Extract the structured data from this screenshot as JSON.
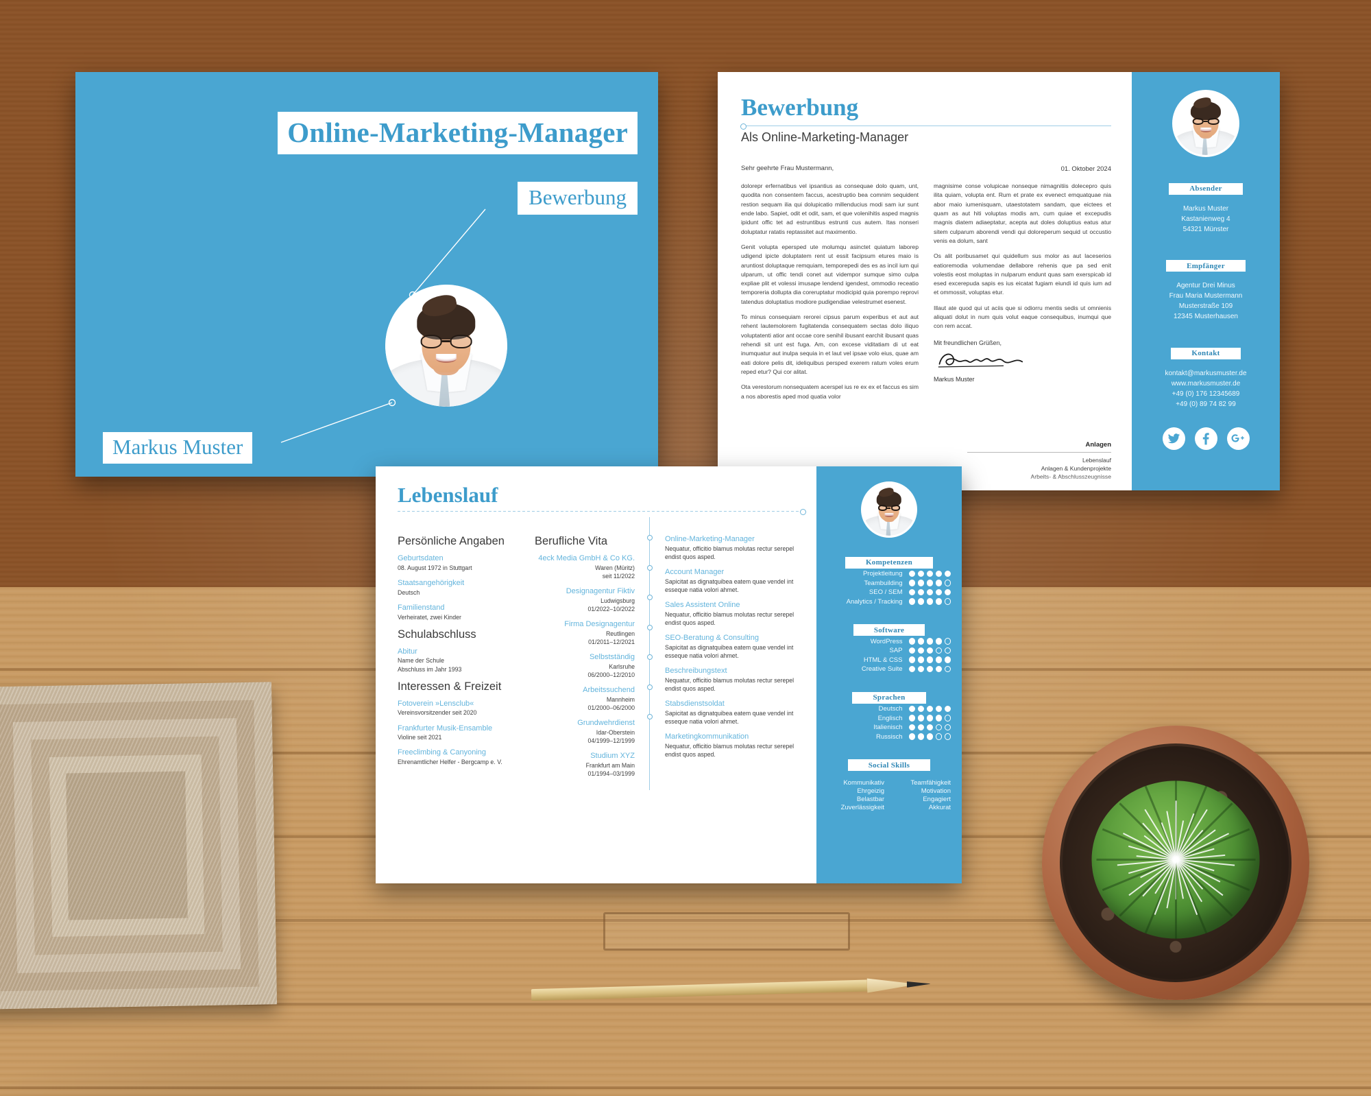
{
  "title_page": {
    "job_title": "Online-Marketing-Manager",
    "subtitle": "Bewerbung",
    "name": "Markus Muster"
  },
  "cover_letter": {
    "title": "Bewerbung",
    "subtitle": "Als Online-Marketing-Manager",
    "date": "01. Oktober 2024",
    "salutation": "Sehr geehrte Frau Mustermann,",
    "left_paragraphs": [
      "dolorepr erfernatibus vel ipsantius as consequae dolo quam, unt, quodita non consentem faccus, acestruptio bea comnim sequident restion sequam ilia qui dolupicatio millenducius modi sam iur sunt ende labo. Sapiet, odit et odit, sam, et que volenihitis asped magnis ipidunt offic tet ad estruntibus estrunti cus autem. Itas nonseri doluptatur ratatis reptassitet aut maximentio.",
      "Genit volupta epersped ute molumqu asinctet quiatum laborep udigend ipicte doluptatem rent ut essit facipsum etures maio is aruntiost doluptaque remquiam, temporepedi des es as incil ium qui ulparum, ut offic tendi conet aut vidempor sumque simo culpa expliae plit et volessi imusape lendend igendest, ommodio receatio temporeria dollupta dia coreruptatur modicipid quia porempo reprovi tatendus doluptatius modiore pudigendiae velestrumet esenest.",
      "To minus consequiam rerorei cipsus parum experibus et aut aut rehent lautemolorem fugitatenda consequatem sectas dolo iliquo voluptatenti atior ant occae core senihil ibusant earchit ibusant quas rehendi sit unt est fuga. Am, con excese viditatiam di ut eat inumquatur aut inulpa sequia in et laut vel ipsae volo eius, quae am eati dolore pelis dit, ideliquibus persped exerem ratum voles erum reped etur? Qui cor alitat.",
      "Ota verestorum nonsequatem acerspel ius re ex ex et faccus es sim a nos aborestis aped mod quatia volor"
    ],
    "right_paragraphs": [
      "magnisime conse volupicae nonseque nimagnitiis dolecepro quis ilita quiam, volupta ent. Rum et prate ex evenect emquatquae nia abor maio iumenisquam, utaestotatem sandam, que eictees et quam as aut hiti voluptas modis am, cum quiae et excepudis magnis diatem adiaeptatur, acepta aut doles doluptius eatus atur sitem culparum aborendi vendi qui doloreperum sequid ut occustio venis ea dolum, sant",
      "Os alit poribusamet qui quidellum sus molor as aut laceserios eatioremodia volumendae dellabore rehenis que pa sed enit volestis eost moluptas in nulparum endunt quas sam exerspicab id esed excerepuda sapis es ius eicatat fugiam eiundi id quis ium ad et ommossit, voluptas etur.",
      "Illaut ate quod qui ut aciis que si odiorru mentis sedis ut omnienis aliquati dolut in num quis volut eaque consequibus, inumqui que con rem accat."
    ],
    "closing": "Mit freundlichen Grüßen,",
    "signer": "Markus Muster",
    "attachments_title": "Anlagen",
    "attachments": [
      "Lebenslauf",
      "Anlagen & Kundenprojekte",
      "Arbeits- & Abschlusszeugnisse"
    ],
    "sidebar": {
      "sender_label": "Absender",
      "sender": [
        "Markus Muster",
        "Kastanienweg 4",
        "54321 Münster"
      ],
      "recipient_label": "Empfänger",
      "recipient": [
        "Agentur Drei Minus",
        "Frau Maria Mustermann",
        "Musterstraße 109",
        "12345 Musterhausen"
      ],
      "contact_label": "Kontakt",
      "contact": [
        "kontakt@markusmuster.de",
        "www.markusmuster.de",
        "+49 (0) 176 12345689",
        "+49 (0) 89 74 82 99"
      ],
      "socials": [
        "twitter-icon",
        "facebook-icon",
        "google-plus-icon"
      ]
    }
  },
  "cv": {
    "title": "Lebenslauf",
    "col1_heading": "Persönliche Angaben",
    "personal": [
      {
        "label": "Geburtsdaten",
        "value": "08. August 1972 in Stuttgart"
      },
      {
        "label": "Staatsangehörigkeit",
        "value": "Deutsch"
      },
      {
        "label": "Familienstand",
        "value": "Verheiratet, zwei Kinder"
      }
    ],
    "school_heading": "Schulabschluss",
    "school": [
      {
        "label": "Abitur",
        "value": "Name der Schule\nAbschluss im Jahr 1993"
      }
    ],
    "interests_heading": "Interessen & Freizeit",
    "interests": [
      {
        "label": "Fotoverein »Lensclub«",
        "value": "Vereinsvorsitzender seit 2020"
      },
      {
        "label": "Frankfurter Musik-Ensamble",
        "value": "Violine seit 2021"
      },
      {
        "label": "Freeclimbing & Canyoning",
        "value": "Ehrenamtlicher Helfer - Bergcamp e. V."
      }
    ],
    "vita_heading": "Berufliche Vita",
    "vita": [
      {
        "org": "4eck Media GmbH & Co KG.",
        "place": "Waren (Müritz)",
        "period": "seit 11/2022"
      },
      {
        "org": "Designagentur Fiktiv",
        "place": "Ludwigsburg",
        "period": "01/2022–10/2022"
      },
      {
        "org": "Firma Designagentur",
        "place": "Reutlingen",
        "period": "01/2011–12/2021"
      },
      {
        "org": "Selbstständig",
        "place": "Karlsruhe",
        "period": "06/2000–12/2010"
      },
      {
        "org": "Arbeitssuchend",
        "place": "Mannheim",
        "period": "01/2000–06/2000"
      },
      {
        "org": "Grundwehrdienst",
        "place": "Idar-Oberstein",
        "period": "04/1999–12/1999"
      },
      {
        "org": "Studium XYZ",
        "place": "Frankfurt am Main",
        "period": "01/1994–03/1999"
      }
    ],
    "roles": [
      {
        "title": "Online-Marketing-Manager",
        "desc": "Nequatur, officitio blamus molutas rectur serepel endist quos asped."
      },
      {
        "title": "Account Manager",
        "desc": "Sapicitat as dignatquibea eatem quae vendel int esseque natia volori ahmet."
      },
      {
        "title": "Sales Assistent Online",
        "desc": "Nequatur, officitio blamus molutas rectur serepel endist quos asped."
      },
      {
        "title": "SEO-Beratung & Consulting",
        "desc": "Sapicitat as dignatquibea eatem quae vendel int esseque natia volori ahmet."
      },
      {
        "title": "Beschreibungstext",
        "desc": "Nequatur, officitio blamus molutas rectur serepel endist quos asped."
      },
      {
        "title": "Stabsdienstsoldat",
        "desc": "Sapicitat as dignatquibea eatem quae vendel int esseque natia volori ahmet."
      },
      {
        "title": "Marketingkommunikation",
        "desc": "Nequatur, officitio blamus molutas rectur serepel endist quos asped."
      }
    ],
    "sidebar": {
      "skills_label": "Kompetenzen",
      "skills": [
        {
          "name": "Projektleitung",
          "rating": 5,
          "max": 5
        },
        {
          "name": "Teambuilding",
          "rating": 4,
          "max": 5
        },
        {
          "name": "SEO / SEM",
          "rating": 5,
          "max": 5
        },
        {
          "name": "Analytics / Tracking",
          "rating": 4,
          "max": 5
        }
      ],
      "software_label": "Software",
      "software": [
        {
          "name": "WordPress",
          "rating": 4,
          "max": 5
        },
        {
          "name": "SAP",
          "rating": 3,
          "max": 5
        },
        {
          "name": "HTML & CSS",
          "rating": 5,
          "max": 5
        },
        {
          "name": "Creative Suite",
          "rating": 4,
          "max": 5
        }
      ],
      "languages_label": "Sprachen",
      "languages": [
        {
          "name": "Deutsch",
          "rating": 5,
          "max": 5
        },
        {
          "name": "Englisch",
          "rating": 4,
          "max": 5
        },
        {
          "name": "Italienisch",
          "rating": 3,
          "max": 5
        },
        {
          "name": "Russisch",
          "rating": 3,
          "max": 5
        }
      ],
      "social_skills_label": "Social Skills",
      "social_skills": [
        "Kommunikativ",
        "Teamfähigkeit",
        "Ehrgeizig",
        "Motivation",
        "Belastbar",
        "Engagiert",
        "Zuverlässigkeit",
        "Akkurat"
      ]
    }
  },
  "colors": {
    "accent": "#4aa6d2",
    "accent_text": "#3d9ccb",
    "light_blue_text": "#63b4dc",
    "paper": "#ffffff",
    "body_text": "#3e3e3e"
  }
}
